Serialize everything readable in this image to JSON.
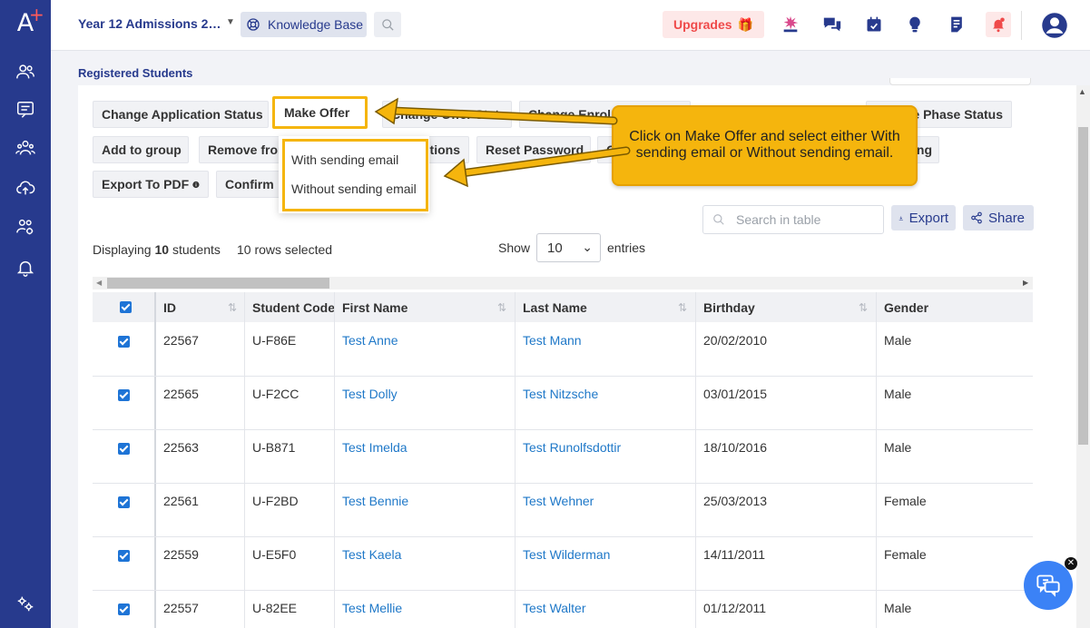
{
  "app": {
    "logo": "A",
    "logo_plus": "+",
    "title": "Year 12 Admissions 2…",
    "knowledge_base": "Knowledge Base",
    "upgrades": "Upgrades",
    "upgrades_icon": "🎁"
  },
  "sidebar": {
    "icons": [
      "users-icon",
      "message-icon",
      "group-icon",
      "cloud-upload-icon",
      "users-settings-icon",
      "bell-icon",
      "settings-icon"
    ]
  },
  "topbar": {
    "icons": [
      "sparkle-icon",
      "chat-bubbles-icon",
      "calendar-icon",
      "lightbulb-icon",
      "document-icon",
      "notification-bell-icon",
      "user-avatar-icon"
    ]
  },
  "breadcrumb": "Registered Students",
  "actions": {
    "change_application_status": "Change Application Status",
    "make_offer": "Make Offer",
    "change_offer_status": "Change Offer Status",
    "change_enrolment": "Change Enrolment Status",
    "change_phase_status": "Change Phase Status",
    "add_to_group": "Add to group",
    "remove_from": "Remove from group",
    "questions": "Questions",
    "reset_password": "Reset Password",
    "c_partial": "C",
    "ng_partial": "ng",
    "export_pdf": "Export To PDF",
    "confirm": "Confirm"
  },
  "dropdown": {
    "with_email": "With sending email",
    "without_email": "Without sending email"
  },
  "callout": "Click on Make Offer and select either With sending email or Without sending email.",
  "table_controls": {
    "search_placeholder": "Search in table",
    "export": "Export",
    "share": "Share",
    "displaying_prefix": "Displaying",
    "displaying_count": "10",
    "displaying_suffix": "students",
    "rows_selected": "10 rows selected",
    "show": "Show",
    "entries_value": "10",
    "entries": "entries"
  },
  "table": {
    "headers": [
      "ID",
      "Student Code",
      "First Name",
      "Last Name",
      "Birthday",
      "Gender"
    ],
    "rows": [
      {
        "id": "22567",
        "code": "U-F86E",
        "first": "Test Anne",
        "last": "Test Mann",
        "birthday": "20/02/2010",
        "gender": "Male"
      },
      {
        "id": "22565",
        "code": "U-F2CC",
        "first": "Test Dolly",
        "last": "Test Nitzsche",
        "birthday": "03/01/2015",
        "gender": "Male"
      },
      {
        "id": "22563",
        "code": "U-B871",
        "first": "Test Imelda",
        "last": "Test Runolfsdottir",
        "birthday": "18/10/2016",
        "gender": "Male"
      },
      {
        "id": "22561",
        "code": "U-F2BD",
        "first": "Test Bennie",
        "last": "Test Wehner",
        "birthday": "25/03/2013",
        "gender": "Female"
      },
      {
        "id": "22559",
        "code": "U-E5F0",
        "first": "Test Kaela",
        "last": "Test Wilderman",
        "birthday": "14/11/2011",
        "gender": "Female"
      },
      {
        "id": "22557",
        "code": "U-82EE",
        "first": "Test Mellie",
        "last": "Test Walter",
        "birthday": "01/12/2011",
        "gender": "Male"
      }
    ]
  },
  "colors": {
    "sidebar": "#273a8d",
    "accent": "#f5b50d",
    "link": "#1f78c8",
    "checkbox": "#1e74d6"
  }
}
